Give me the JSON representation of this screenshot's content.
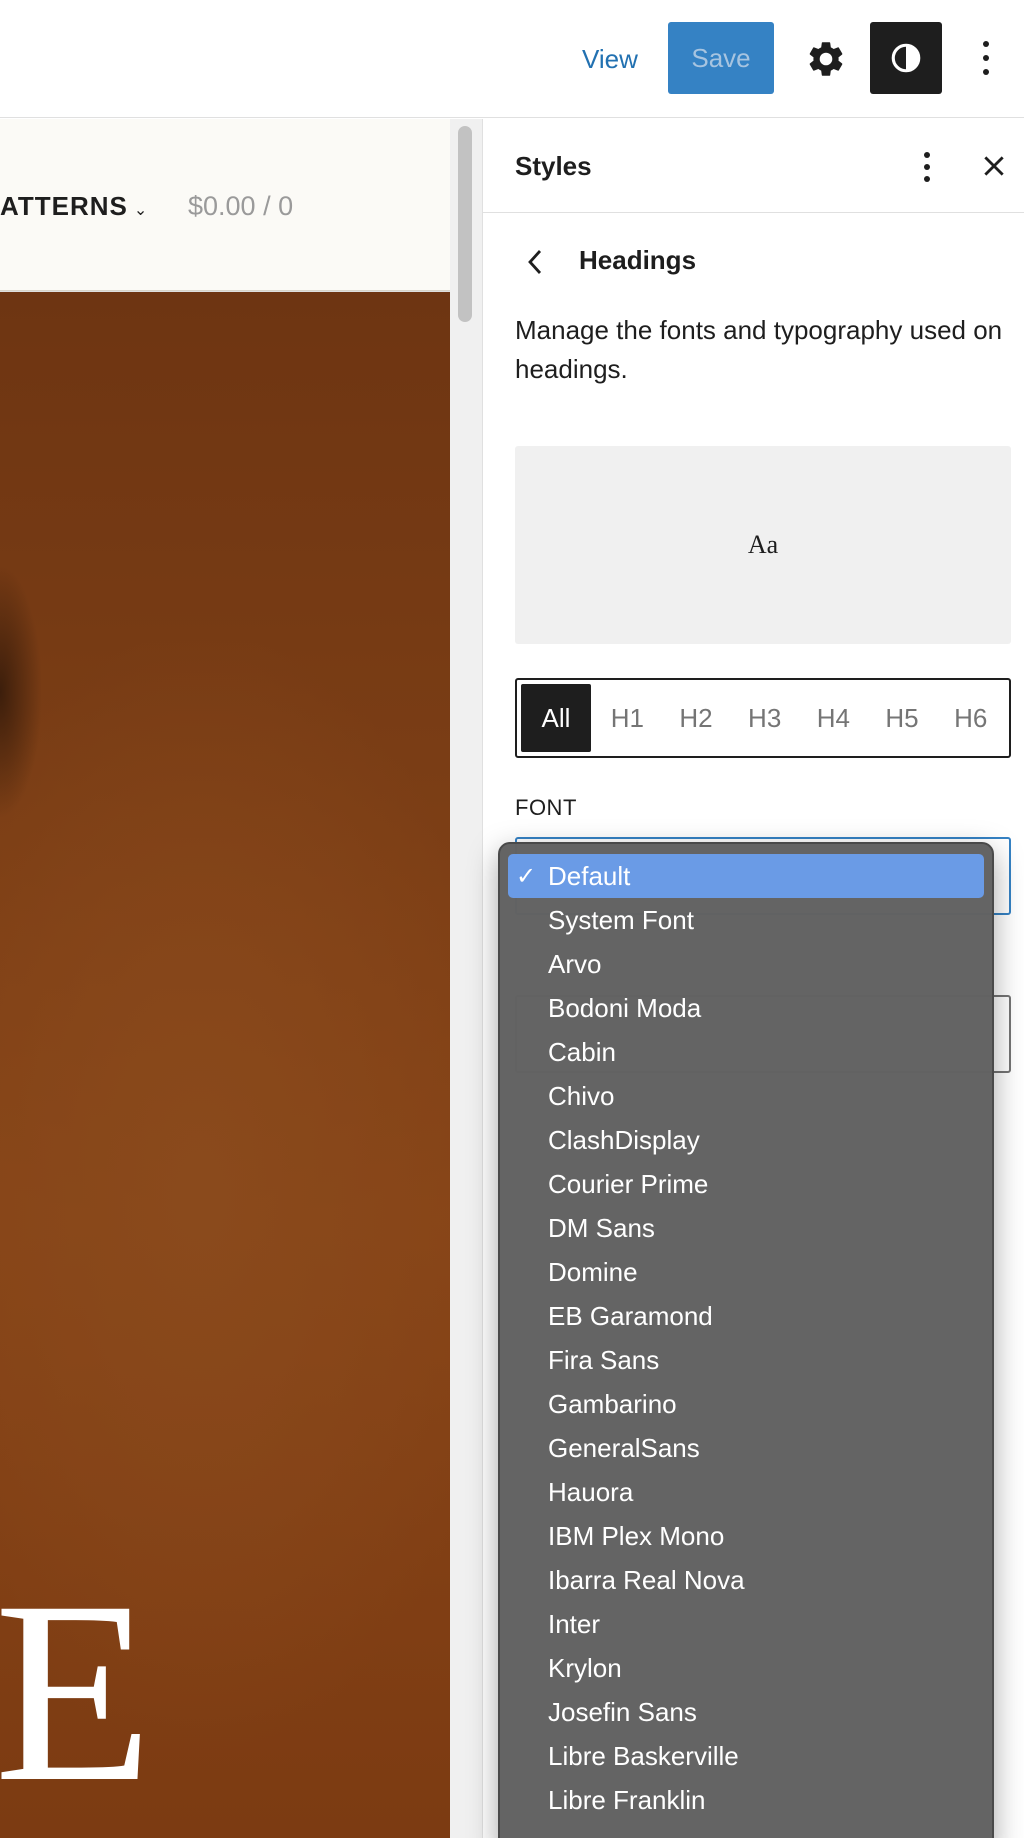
{
  "topbar": {
    "view_label": "View",
    "save_label": "Save"
  },
  "canvas": {
    "nav_item": "ATTERNS",
    "cart": "$0.00 / 0",
    "hero_text": "E"
  },
  "sidebar": {
    "title": "Styles",
    "section_title": "Headings",
    "section_description": "Manage the fonts and typography used on headings.",
    "preview_text": "Aa",
    "levels": [
      "All",
      "H1",
      "H2",
      "H3",
      "H4",
      "H5",
      "H6"
    ],
    "active_level": "All",
    "font_label": "FONT"
  },
  "font_dropdown": {
    "selected": "Default",
    "check_mark": "✓",
    "options": [
      "Default",
      "System Font",
      "Arvo",
      "Bodoni Moda",
      "Cabin",
      "Chivo",
      "ClashDisplay",
      "Courier Prime",
      "DM Sans",
      "Domine",
      "EB Garamond",
      "Fira Sans",
      "Gambarino",
      "GeneralSans",
      "Hauora",
      "IBM Plex Mono",
      "Ibarra Real Nova",
      "Inter",
      "Krylon",
      "Josefin Sans",
      "Libre Baskerville",
      "Libre Franklin"
    ]
  },
  "colors": {
    "accent": "#3582c4",
    "link": "#2271b1",
    "dark": "#1e1e1e",
    "dropdown_bg": "#626262",
    "dropdown_selected": "#6a9be6",
    "hero_brown": "#7a3d15"
  },
  "icons": [
    "gear-icon",
    "contrast-icon",
    "more-vertical-icon",
    "close-icon",
    "chevron-left-icon",
    "chevron-down-icon",
    "check-icon"
  ]
}
